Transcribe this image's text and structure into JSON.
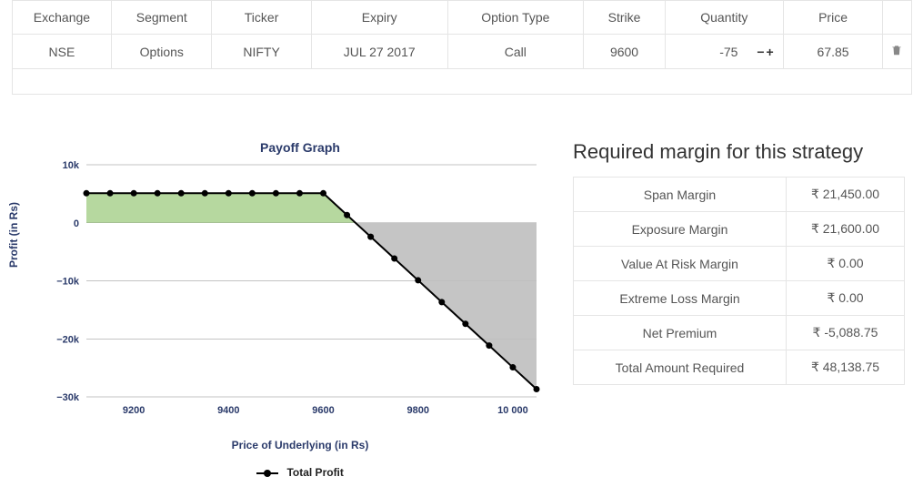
{
  "position_table": {
    "headers": [
      "Exchange",
      "Segment",
      "Ticker",
      "Expiry",
      "Option Type",
      "Strike",
      "Quantity",
      "Price"
    ],
    "row": {
      "exchange": "NSE",
      "segment": "Options",
      "ticker": "NIFTY",
      "expiry": "JUL 27 2017",
      "option_type": "Call",
      "strike": "9600",
      "quantity": "-75",
      "price": "67.85"
    }
  },
  "chart": {
    "title": "Payoff Graph",
    "xlabel": "Price of Underlying (in Rs)",
    "ylabel": "Profit (in Rs)",
    "legend": "Total Profit",
    "yticks": [
      "10k",
      "0",
      "−10k",
      "−20k",
      "−30k"
    ],
    "xticks": [
      "9200",
      "9400",
      "9600",
      "9800",
      "10 000"
    ]
  },
  "chart_data": {
    "type": "line",
    "title": "Payoff Graph",
    "xlabel": "Price of Underlying (in Rs)",
    "ylabel": "Profit (in Rs)",
    "xlim": [
      9100,
      10050
    ],
    "ylim": [
      -30000,
      10000
    ],
    "series": [
      {
        "name": "Total Profit",
        "x": [
          9100,
          9150,
          9200,
          9250,
          9300,
          9350,
          9400,
          9450,
          9500,
          9550,
          9600,
          9650,
          9700,
          9750,
          9800,
          9850,
          9900,
          9950,
          10000,
          10050
        ],
        "y": [
          5089,
          5089,
          5089,
          5089,
          5089,
          5089,
          5089,
          5089,
          5089,
          5089,
          5089,
          1339,
          -2411,
          -6161,
          -9911,
          -13661,
          -17411,
          -21161,
          -24911,
          -28661
        ]
      }
    ],
    "fill_above_zero_color": "#a9d18e",
    "fill_below_zero_color": "#bfbfbf"
  },
  "margin": {
    "title": "Required margin for this strategy",
    "rows": [
      {
        "label": "Span Margin",
        "value": "₹ 21,450.00"
      },
      {
        "label": "Exposure Margin",
        "value": "₹ 21,600.00"
      },
      {
        "label": "Value At Risk Margin",
        "value": "₹ 0.00"
      },
      {
        "label": "Extreme Loss Margin",
        "value": "₹ 0.00"
      },
      {
        "label": "Net Premium",
        "value": "₹ -5,088.75"
      },
      {
        "label": "Total Amount Required",
        "value": "₹ 48,138.75"
      }
    ]
  }
}
